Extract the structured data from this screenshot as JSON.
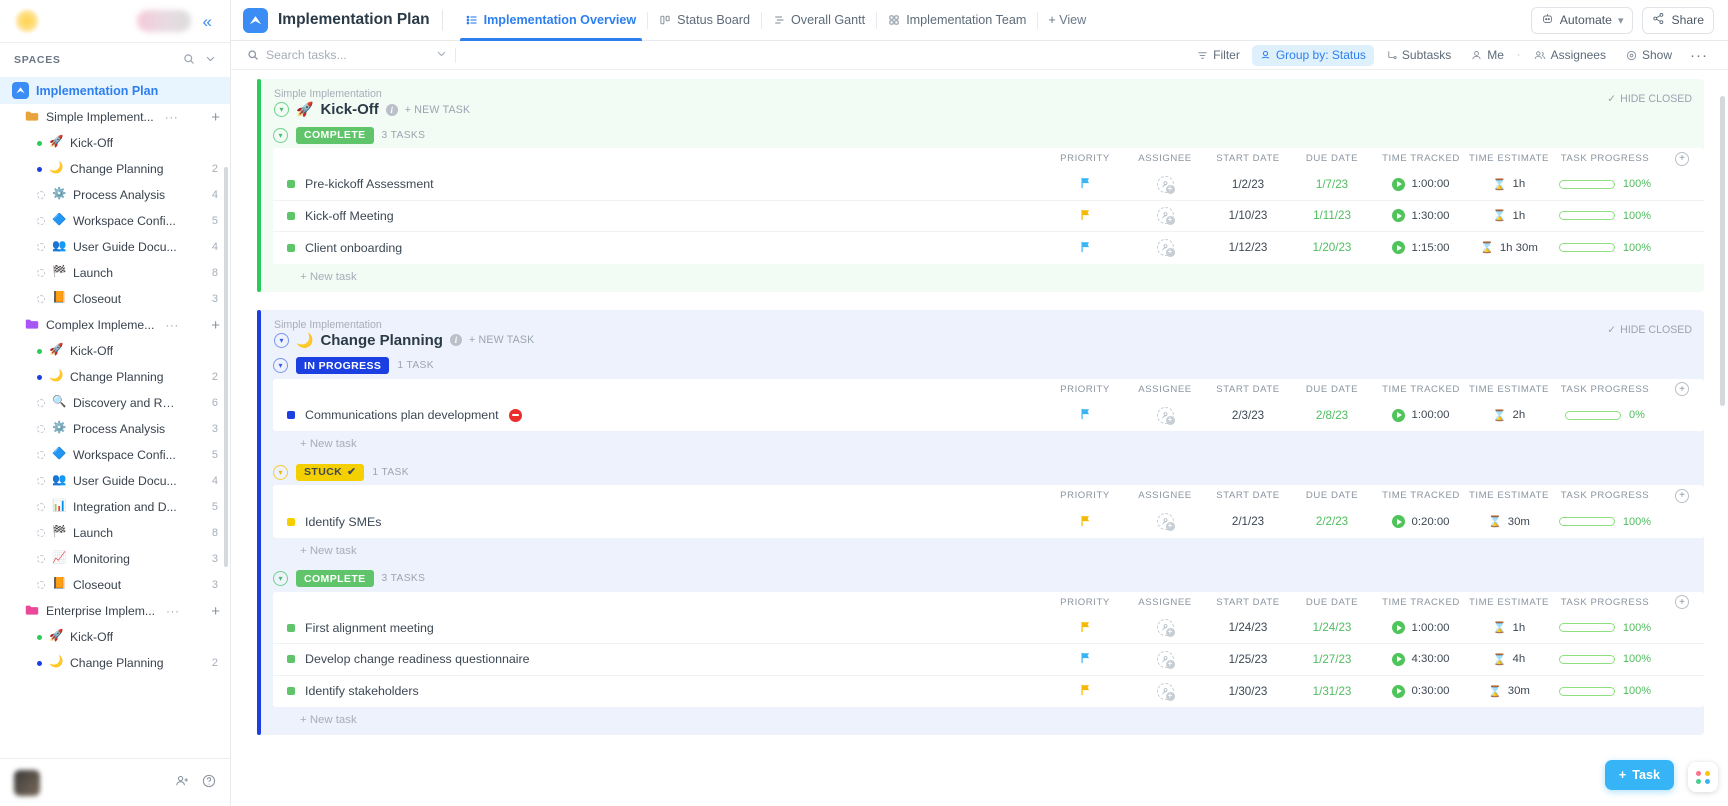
{
  "sidebar": {
    "spaces_label": "SPACES",
    "space": {
      "name": "Implementation Plan",
      "icon": "clickup-logo-icon"
    },
    "tree": [
      {
        "type": "folder",
        "name": "Simple Implement...",
        "icon": "folder-orange-icon",
        "dots": "···",
        "plus": "+"
      },
      {
        "type": "list",
        "name": "Kick-Off",
        "icon": "🚀",
        "count": "",
        "dot": "green"
      },
      {
        "type": "list",
        "name": "Change Planning",
        "icon": "🌙",
        "count": "2",
        "dot": "blue"
      },
      {
        "type": "list",
        "name": "Process Analysis",
        "icon": "⚙️",
        "count": "4",
        "dot": "hollow"
      },
      {
        "type": "list",
        "name": "Workspace Confi...",
        "icon": "🔷",
        "count": "5",
        "dot": "hollow"
      },
      {
        "type": "list",
        "name": "User Guide Docu...",
        "icon": "👥",
        "count": "4",
        "dot": "hollow"
      },
      {
        "type": "list",
        "name": "Launch",
        "icon": "🏁",
        "count": "8",
        "dot": "hollow"
      },
      {
        "type": "list",
        "name": "Closeout",
        "icon": "📙",
        "count": "3",
        "dot": "hollow"
      },
      {
        "type": "folder",
        "name": "Complex Impleme...",
        "icon": "folder-purple-icon",
        "dots": "···",
        "plus": "+"
      },
      {
        "type": "list",
        "name": "Kick-Off",
        "icon": "🚀",
        "count": "",
        "dot": "green"
      },
      {
        "type": "list",
        "name": "Change Planning",
        "icon": "🌙",
        "count": "2",
        "dot": "blue"
      },
      {
        "type": "list",
        "name": "Discovery and Re...",
        "icon": "🔍",
        "count": "6",
        "dot": "hollow"
      },
      {
        "type": "list",
        "name": "Process Analysis",
        "icon": "⚙️",
        "count": "3",
        "dot": "hollow"
      },
      {
        "type": "list",
        "name": "Workspace Confi...",
        "icon": "🔷",
        "count": "5",
        "dot": "hollow"
      },
      {
        "type": "list",
        "name": "User Guide Docu...",
        "icon": "👥",
        "count": "4",
        "dot": "hollow"
      },
      {
        "type": "list",
        "name": "Integration and D...",
        "icon": "📊",
        "count": "5",
        "dot": "hollow"
      },
      {
        "type": "list",
        "name": "Launch",
        "icon": "🏁",
        "count": "8",
        "dot": "hollow"
      },
      {
        "type": "list",
        "name": "Monitoring",
        "icon": "📈",
        "count": "3",
        "dot": "hollow"
      },
      {
        "type": "list",
        "name": "Closeout",
        "icon": "📙",
        "count": "3",
        "dot": "hollow"
      },
      {
        "type": "folder",
        "name": "Enterprise Implem...",
        "icon": "folder-pink-icon",
        "dots": "···",
        "plus": "+"
      },
      {
        "type": "list",
        "name": "Kick-Off",
        "icon": "🚀",
        "count": "",
        "dot": "green"
      },
      {
        "type": "list",
        "name": "Change Planning",
        "icon": "🌙",
        "count": "2",
        "dot": "blue"
      }
    ]
  },
  "topbar": {
    "title": "Implementation Plan",
    "tabs": [
      {
        "label": "Implementation Overview",
        "icon": "list-view-icon",
        "active": true
      },
      {
        "label": "Status Board",
        "icon": "board-view-icon",
        "active": false
      },
      {
        "label": "Overall Gantt",
        "icon": "gantt-view-icon",
        "active": false
      },
      {
        "label": "Implementation Team",
        "icon": "team-view-icon",
        "active": false
      }
    ],
    "add_view": "+ View",
    "automate": "Automate",
    "share": "Share"
  },
  "toolbar": {
    "search_placeholder": "Search tasks...",
    "search_value": "",
    "filter": "Filter",
    "group_by": "Group by: Status",
    "subtasks": "Subtasks",
    "me": "Me",
    "assignees": "Assignees",
    "show": "Show",
    "more": "···"
  },
  "columns": {
    "priority": "PRIORITY",
    "assignee": "ASSIGNEE",
    "start_date": "START DATE",
    "due_date": "DUE DATE",
    "time_tracked": "TIME TRACKED",
    "time_estimate": "TIME ESTIMATE",
    "task_progress": "TASK PROGRESS"
  },
  "labels": {
    "new_task_link": "+ NEW TASK",
    "hide_closed": "HIDE CLOSED",
    "new_task_row": "+ New task",
    "fab_task": "Task"
  },
  "sections": [
    {
      "crumb": "Simple Implementation",
      "title": "Kick-Off",
      "emoji": "🚀",
      "theme": "kickoff",
      "groups": [
        {
          "status": "COMPLETE",
          "status_class": "complete",
          "count": "3 TASKS",
          "tasks": [
            {
              "name": "Pre-kickoff Assessment",
              "sq": "#5fc46a",
              "flag": "#36b4f5",
              "start": "1/2/23",
              "due": "1/7/23",
              "tracked": "1:00:00",
              "estimate": "1h",
              "progress": 100,
              "progress_label": "100%"
            },
            {
              "name": "Kick-off Meeting",
              "sq": "#5fc46a",
              "flag": "#f5b800",
              "start": "1/10/23",
              "due": "1/11/23",
              "tracked": "1:30:00",
              "estimate": "1h",
              "progress": 100,
              "progress_label": "100%"
            },
            {
              "name": "Client onboarding",
              "sq": "#5fc46a",
              "flag": "#36b4f5",
              "start": "1/12/23",
              "due": "1/20/23",
              "tracked": "1:15:00",
              "estimate": "1h 30m",
              "progress": 100,
              "progress_label": "100%"
            }
          ]
        }
      ]
    },
    {
      "crumb": "Simple Implementation",
      "title": "Change Planning",
      "emoji": "🌙",
      "theme": "change",
      "groups": [
        {
          "status": "IN PROGRESS",
          "status_class": "inprogress",
          "count": "1 TASK",
          "tasks": [
            {
              "name": "Communications plan development",
              "sq": "#1b3fe0",
              "flag": "#36b4f5",
              "blocked": true,
              "start": "2/3/23",
              "due": "2/8/23",
              "tracked": "1:00:00",
              "estimate": "2h",
              "progress": 0,
              "progress_label": "0%"
            }
          ]
        },
        {
          "status": "STUCK",
          "status_class": "stuck",
          "count": "1 TASK",
          "tasks": [
            {
              "name": "Identify SMEs",
              "sq": "#f5d000",
              "flag": "#f5b800",
              "start": "2/1/23",
              "due": "2/2/23",
              "tracked": "0:20:00",
              "estimate": "30m",
              "progress": 100,
              "progress_label": "100%"
            }
          ]
        },
        {
          "status": "COMPLETE",
          "status_class": "complete",
          "count": "3 TASKS",
          "tasks": [
            {
              "name": "First alignment meeting",
              "sq": "#5fc46a",
              "flag": "#f5b800",
              "start": "1/24/23",
              "due": "1/24/23",
              "tracked": "1:00:00",
              "estimate": "1h",
              "progress": 100,
              "progress_label": "100%"
            },
            {
              "name": "Develop change readiness questionnaire",
              "sq": "#5fc46a",
              "flag": "#36b4f5",
              "start": "1/25/23",
              "due": "1/27/23",
              "tracked": "4:30:00",
              "estimate": "4h",
              "progress": 100,
              "progress_label": "100%"
            },
            {
              "name": "Identify stakeholders",
              "sq": "#5fc46a",
              "flag": "#f5b800",
              "start": "1/30/23",
              "due": "1/31/23",
              "tracked": "0:30:00",
              "estimate": "30m",
              "progress": 100,
              "progress_label": "100%"
            }
          ]
        }
      ]
    }
  ]
}
